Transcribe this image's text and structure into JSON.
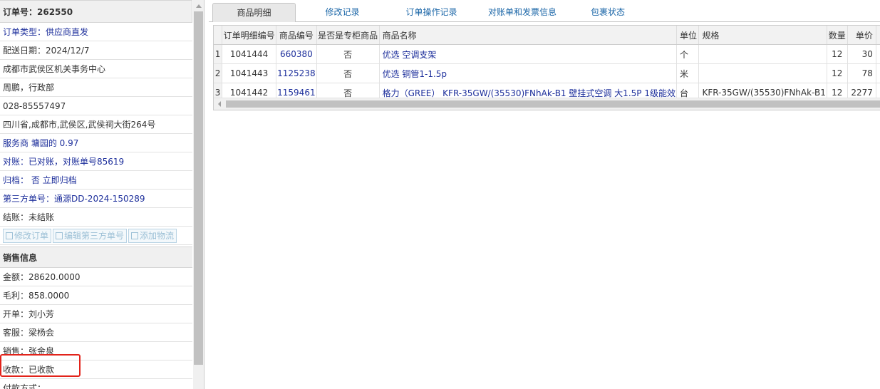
{
  "left": {
    "order_header": "订单号：262550",
    "rows": [
      {
        "text": "订单类型：供应商直发",
        "blue": true
      },
      {
        "text": "配送日期：2024/12/7",
        "blue": false
      },
      {
        "text": "成都市武侯区机关事务中心",
        "blue": false
      },
      {
        "text": "周鹏，行政部",
        "blue": false
      },
      {
        "text": "028-85557497",
        "blue": false
      },
      {
        "text": "四川省,成都市,武侯区,武侯祠大街264号",
        "blue": false
      },
      {
        "text": "服务商 墉园的 0.97",
        "blue": true
      },
      {
        "text": "对账：已对账，对账单号85619",
        "blue": true
      },
      {
        "text": "归档： 否 立即归档",
        "blue": true
      },
      {
        "text": "第三方单号：通源DD-2024-150289",
        "blue": true
      },
      {
        "text": "结账：未结账",
        "blue": false
      }
    ],
    "buttons": {
      "edit_order": "修改订单",
      "edit_third_party": "编辑第三方单号",
      "add_logistics": "添加物流"
    },
    "sales_header": "销售信息",
    "sales_rows": [
      "金额：28620.0000",
      "毛利：858.0000",
      "开单：刘小芳",
      "客服：梁杨会",
      "销售：张金泉",
      "收款：已收款",
      "付款方式："
    ]
  },
  "tabs": [
    "商品明细",
    "修改记录",
    "订单操作记录",
    "对账单和发票信息",
    "包裹状态"
  ],
  "table": {
    "headers": [
      "",
      "订单明细编号",
      "商品编号",
      "是否是专柜商品",
      "商品名称",
      "单位",
      "规格",
      "数量",
      "单价"
    ],
    "rows": [
      [
        "1",
        "1041444",
        "660380",
        "否",
        "优选 空调支架",
        "个",
        "",
        "12",
        "30"
      ],
      [
        "2",
        "1041443",
        "1125238",
        "否",
        "优选 铜管1-1.5p",
        "米",
        "",
        "12",
        "78"
      ],
      [
        "3",
        "1041442",
        "1159461",
        "否",
        "格力（GREE） KFR-35GW/(35530)FNhAk-B1 壁挂式空调 大1.5P 1级能效",
        "台",
        "KFR-35GW/(35530)FNhAk-B1",
        "12",
        "2277"
      ]
    ]
  }
}
